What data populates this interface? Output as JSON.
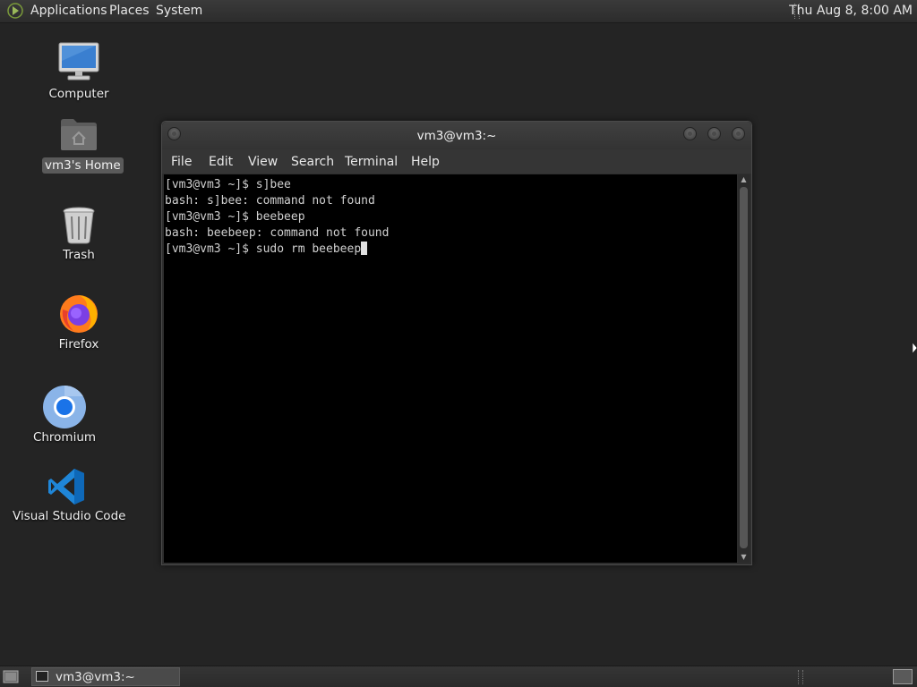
{
  "top_panel": {
    "menus": [
      "Applications",
      "Places",
      "System"
    ],
    "clock": "Thu Aug  8,  8:00 AM"
  },
  "desktop_icons": [
    {
      "label": "Computer",
      "icon": "computer-icon"
    },
    {
      "label": "vm3's Home",
      "icon": "home-folder-icon",
      "selected": true
    },
    {
      "label": "Trash",
      "icon": "trash-icon"
    },
    {
      "label": "Firefox",
      "icon": "firefox-icon"
    },
    {
      "label": "Chromium",
      "icon": "chromium-icon"
    },
    {
      "label": "Visual Studio Code",
      "icon": "vscode-icon"
    }
  ],
  "terminal": {
    "title": "vm3@vm3:~",
    "menu": [
      "File",
      "Edit",
      "View",
      "Search",
      "Terminal",
      "Help"
    ],
    "lines": [
      "[vm3@vm3 ~]$ s]bee",
      "bash: s]bee: command not found",
      "[vm3@vm3 ~]$ beebeep",
      "bash: beebeep: command not found",
      "[vm3@vm3 ~]$ sudo rm beebeep"
    ]
  },
  "taskbar": {
    "tasks": [
      {
        "label": "vm3@vm3:~"
      }
    ]
  },
  "colors": {
    "desktop_bg": "#242424",
    "terminal_bg": "#000000",
    "terminal_fg": "#d0d0d0",
    "panel_bg": "#333333"
  }
}
